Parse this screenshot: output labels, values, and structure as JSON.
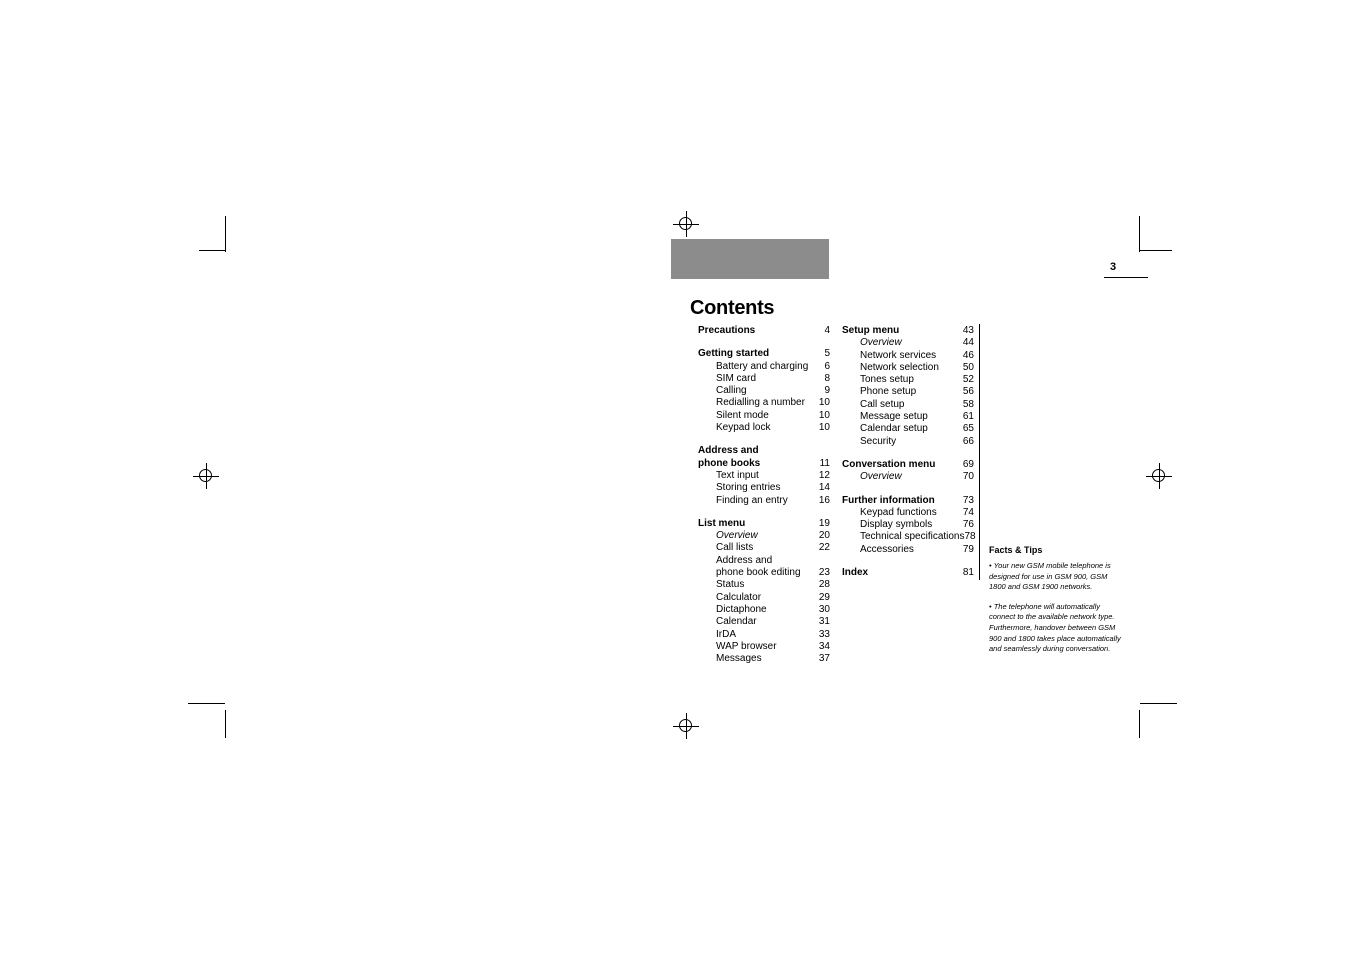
{
  "page": {
    "number": "3",
    "title": "Contents"
  },
  "toc": {
    "column_1": [
      {
        "type": "head",
        "label": "Precautions",
        "page": "4"
      },
      {
        "type": "spacer"
      },
      {
        "type": "head",
        "label": "Getting started",
        "page": "5"
      },
      {
        "type": "sub",
        "label": "Battery and charging",
        "page": "6"
      },
      {
        "type": "sub",
        "label": "SIM card",
        "page": "8"
      },
      {
        "type": "sub",
        "label": "Calling",
        "page": "9"
      },
      {
        "type": "sub",
        "label": "Redialling a number",
        "page": "10"
      },
      {
        "type": "sub",
        "label": "Silent mode",
        "page": "10"
      },
      {
        "type": "sub",
        "label": "Keypad lock",
        "page": "10"
      },
      {
        "type": "spacer"
      },
      {
        "type": "head",
        "label": "Address and",
        "page": ""
      },
      {
        "type": "head",
        "label": "phone books",
        "page": "11"
      },
      {
        "type": "sub",
        "label": "Text input",
        "page": "12"
      },
      {
        "type": "sub",
        "label": "Storing entries",
        "page": "14"
      },
      {
        "type": "sub",
        "label": "Finding an entry",
        "page": "16"
      },
      {
        "type": "spacer"
      },
      {
        "type": "head",
        "label": "List menu",
        "page": "19"
      },
      {
        "type": "subi",
        "label": "Overview",
        "page": "20"
      },
      {
        "type": "sub",
        "label": "Call lists",
        "page": "22"
      },
      {
        "type": "sub",
        "label": "Address and",
        "page": ""
      },
      {
        "type": "sub",
        "label": "phone book editing",
        "page": "23"
      },
      {
        "type": "sub",
        "label": "Status",
        "page": "28"
      },
      {
        "type": "sub",
        "label": "Calculator",
        "page": "29"
      },
      {
        "type": "sub",
        "label": "Dictaphone",
        "page": "30"
      },
      {
        "type": "sub",
        "label": "Calendar",
        "page": "31"
      },
      {
        "type": "sub",
        "label": "IrDA",
        "page": "33"
      },
      {
        "type": "sub",
        "label": "WAP browser",
        "page": "34"
      },
      {
        "type": "sub",
        "label": "Messages",
        "page": "37"
      }
    ],
    "column_2": [
      {
        "type": "head",
        "label": "Setup menu",
        "page": "43"
      },
      {
        "type": "subi",
        "label": "Overview",
        "page": "44"
      },
      {
        "type": "sub",
        "label": "Network services",
        "page": "46"
      },
      {
        "type": "sub",
        "label": "Network selection",
        "page": "50"
      },
      {
        "type": "sub",
        "label": "Tones setup",
        "page": "52"
      },
      {
        "type": "sub",
        "label": "Phone setup",
        "page": "56"
      },
      {
        "type": "sub",
        "label": "Call setup",
        "page": "58"
      },
      {
        "type": "sub",
        "label": "Message setup",
        "page": "61"
      },
      {
        "type": "sub",
        "label": "Calendar setup",
        "page": "65"
      },
      {
        "type": "sub",
        "label": "Security",
        "page": "66"
      },
      {
        "type": "spacer"
      },
      {
        "type": "head",
        "label": "Conversation menu",
        "page": "69"
      },
      {
        "type": "subi",
        "label": "Overview",
        "page": "70"
      },
      {
        "type": "spacer"
      },
      {
        "type": "head",
        "label": "Further information",
        "page": "73"
      },
      {
        "type": "sub",
        "label": "Keypad functions",
        "page": "74"
      },
      {
        "type": "sub",
        "label": "Display symbols",
        "page": "76"
      },
      {
        "type": "sub",
        "label": "Technical specifications",
        "page": "78"
      },
      {
        "type": "sub",
        "label": "Accessories",
        "page": "79"
      },
      {
        "type": "spacer"
      },
      {
        "type": "head",
        "label": "Index",
        "page": "81"
      }
    ]
  },
  "facts": {
    "title": "Facts & Tips",
    "items": [
      "• Your new GSM mobile telephone is designed for use in GSM 900, GSM 1800 and GSM 1900 networks.",
      "• The telephone will automatically connect to the available network type. Furthermore, handover between GSM 900 and 1800 takes place automatically and seamlessly during conversation."
    ]
  }
}
